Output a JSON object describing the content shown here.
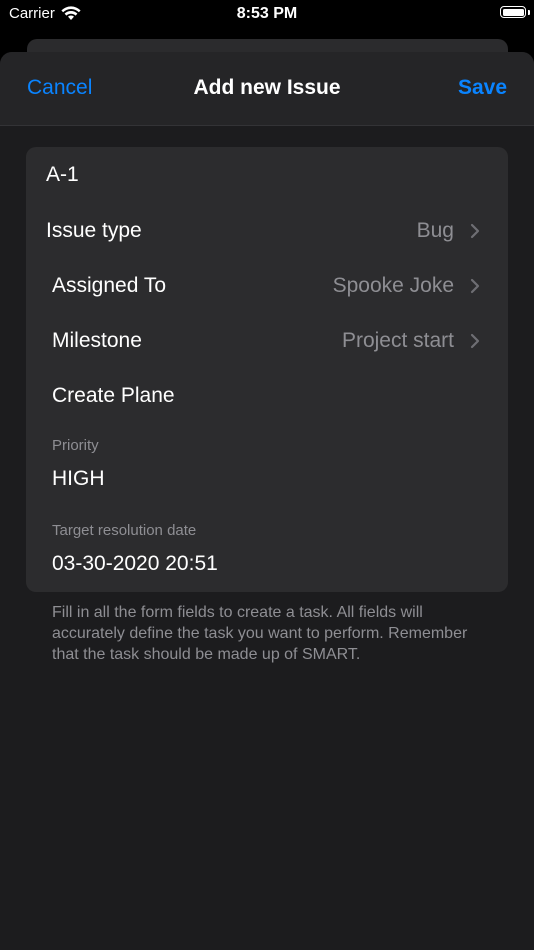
{
  "status_bar": {
    "carrier": "Carrier",
    "time": "8:53 PM",
    "wifi_icon": "wifi-icon",
    "battery_icon": "battery-icon"
  },
  "nav": {
    "cancel_label": "Cancel",
    "title": "Add new Issue",
    "save_label": "Save"
  },
  "form": {
    "issue_id": "A-1",
    "issue_type": {
      "label": "Issue type",
      "value": "Bug"
    },
    "assigned_to": {
      "label": "Assigned To",
      "value": "Spooke Joke"
    },
    "milestone": {
      "label": "Milestone",
      "value": "Project start"
    },
    "title": "Create Plane",
    "priority": {
      "label": "Priority",
      "value": "HIGH"
    },
    "target_date": {
      "label": "Target resolution date",
      "value": "03-30-2020 20:51"
    }
  },
  "footer_note": "Fill in all the form fields to create a task. All fields will accurately define the task you want to perform. Remember that the task should be made up of SMART.",
  "colors": {
    "accent": "#0a84ff",
    "sheet_background": "#1c1c1e",
    "group_background": "#2c2c2e",
    "secondary_text": "#8e8e93"
  }
}
